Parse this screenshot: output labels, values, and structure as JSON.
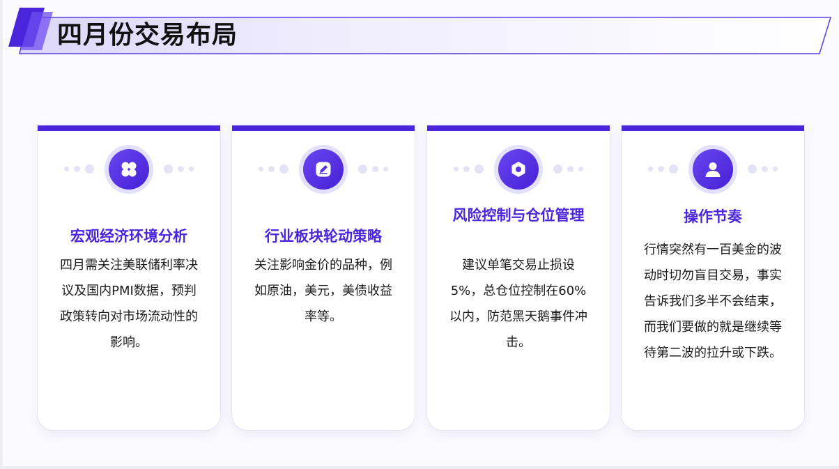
{
  "header": {
    "title": "四月份交易布局"
  },
  "colors": {
    "accent": "#4a25dc",
    "icon_ring": "#e2e0fb",
    "dots": "#e4e3f6",
    "card_bg": "#ffffff"
  },
  "cards": [
    {
      "icon": "clover-icon",
      "title": "宏观经济环境分析",
      "body": "四月需关注美联储利率决议及国内PMI数据，预判政策转向对市场流动性的影响。"
    },
    {
      "icon": "pen-icon",
      "title": "行业板块轮动策略",
      "body": "关注影响金价的品种，例如原油，美元，美债收益率等。"
    },
    {
      "icon": "hex-nut-icon",
      "title": "风险控制与仓位管理",
      "body": "建议单笔交易止损设5%，总仓位控制在60%以内，防范黑天鹅事件冲击。"
    },
    {
      "icon": "user-icon",
      "title": "操作节奏",
      "body": "行情突然有一百美金的波动时切勿盲目交易，事实告诉我们多半不会结束，而我们要做的就是继续等待第二波的拉升或下跌。"
    }
  ]
}
